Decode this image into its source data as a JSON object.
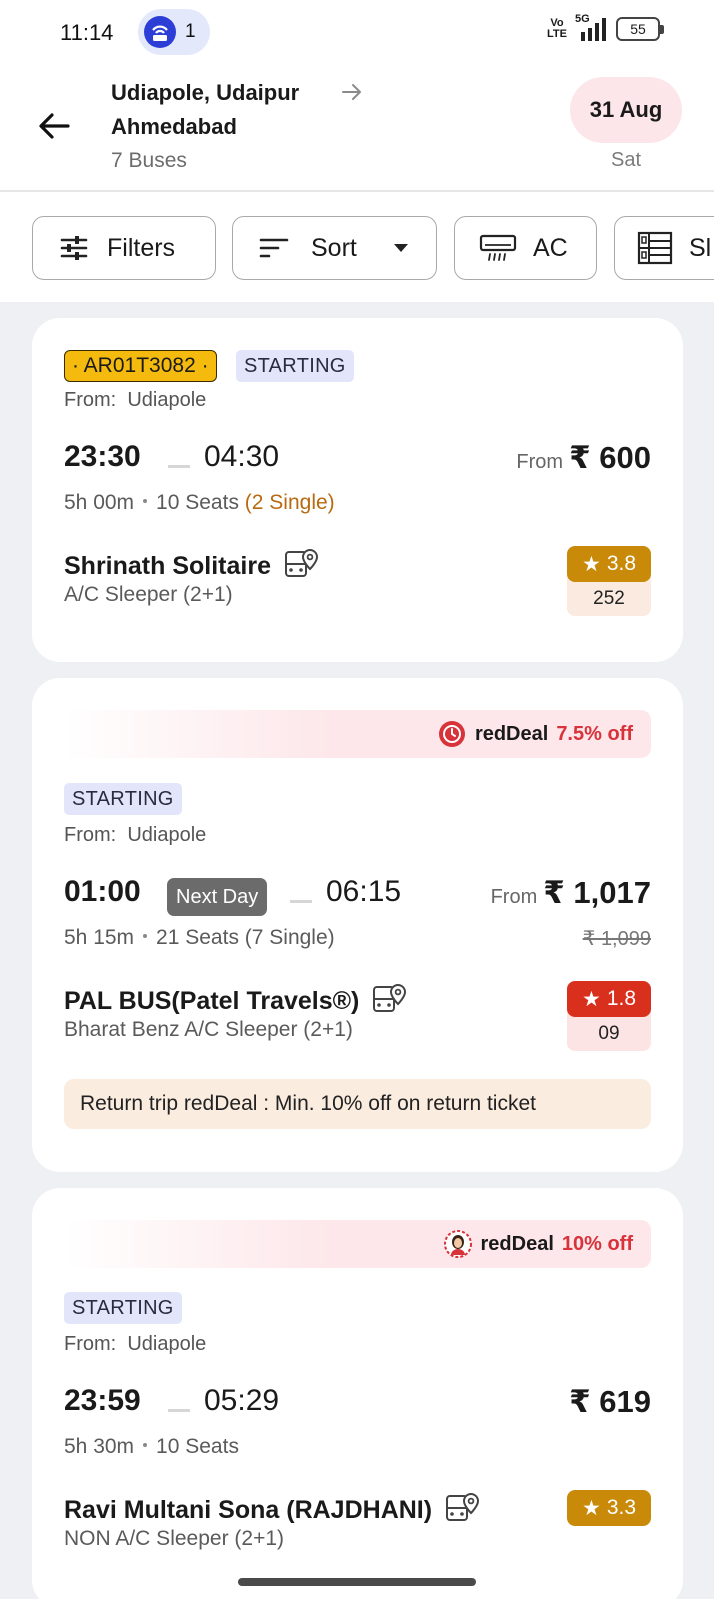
{
  "status_bar": {
    "time": "11:14",
    "hotspot_count": "1",
    "volte": "Vo LTE",
    "network": "5G",
    "battery": "55"
  },
  "header": {
    "from": "Udiapole, Udaipur",
    "to": "Ahmedabad",
    "bus_count": "7 Buses",
    "date": "31 Aug",
    "day": "Sat"
  },
  "filters": {
    "chips": [
      {
        "label": "Filters",
        "icon": "sliders-icon"
      },
      {
        "label": "Sort",
        "icon": "sort-icon"
      },
      {
        "label": "AC",
        "icon": "air-conditioner-icon"
      },
      {
        "label": "Sl",
        "icon": "sleeper-icon"
      }
    ]
  },
  "buses": [
    {
      "reg_number": "· AR01T3082 ·",
      "tag": "STARTING",
      "from_label": "From:",
      "boarding": "Udiapole",
      "depart": "23:30",
      "arrive": "04:30",
      "duration": "5h 00m",
      "seats": "10 Seats",
      "single": "(2 Single)",
      "price_prefix": "From",
      "price": "₹ 600",
      "operator": "Shrinath Solitaire",
      "bus_type": "A/C Sleeper (2+1)",
      "rating": "3.8",
      "rating_count": "252",
      "rating_color": "#c98a0a"
    },
    {
      "deal_label": "redDeal",
      "deal_off": "7.5% off",
      "tag": "STARTING",
      "from_label": "From:",
      "boarding": "Udiapole",
      "depart": "01:00",
      "next_day": "Next Day",
      "arrive": "06:15",
      "duration": "5h 15m",
      "seats": "21 Seats (7 Single)",
      "price_prefix": "From",
      "price": "₹ 1,017",
      "original_price": "₹ 1,099",
      "operator": "PAL BUS(Patel Travels®)",
      "bus_type": "Bharat Benz A/C Sleeper (2+1)",
      "rating": "1.8",
      "rating_count": "09",
      "rating_color": "#d9301e",
      "return_deal": "Return trip redDeal : Min. 10% off on return ticket"
    },
    {
      "deal_label": "redDeal",
      "deal_off": "10% off",
      "tag": "STARTING",
      "from_label": "From:",
      "boarding": "Udiapole",
      "depart": "23:59",
      "arrive": "05:29",
      "duration": "5h 30m",
      "seats": "10 Seats",
      "price": "₹ 619",
      "operator": "Ravi Multani Sona (RAJDHANI)",
      "bus_type": "NON A/C Sleeper (2+1)",
      "rating": "3.3",
      "rating_color": "#c98a0a"
    }
  ],
  "colors": {
    "accent_red": "#d8323a",
    "deal_bg": "#fde7ea",
    "reg_yellow": "#f4bb0e",
    "starting_bg": "#e3e6fb"
  }
}
